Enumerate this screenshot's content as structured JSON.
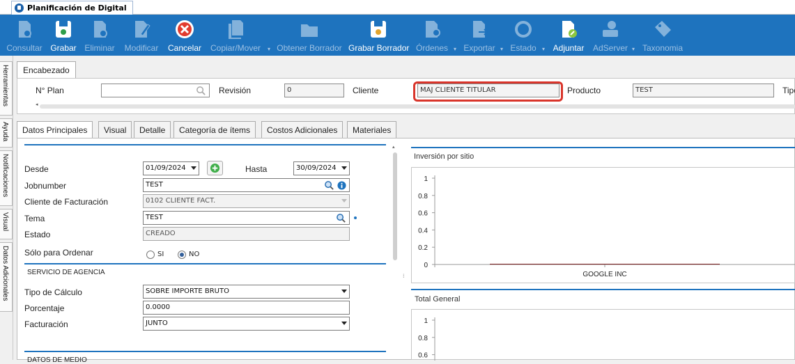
{
  "window": {
    "title": "Planificación de Digital"
  },
  "toolbar": {
    "buttons": [
      {
        "label": "Consultar",
        "icon": "consult-icon",
        "enabled": false
      },
      {
        "label": "Grabar",
        "icon": "save-icon",
        "enabled": true
      },
      {
        "label": "Eliminar",
        "icon": "delete-icon",
        "enabled": false
      },
      {
        "label": "Modificar",
        "icon": "edit-icon",
        "enabled": false
      },
      {
        "label": "Cancelar",
        "icon": "cancel-icon",
        "enabled": true
      },
      {
        "label": "Copiar/Mover",
        "icon": "copy-icon",
        "enabled": false
      },
      {
        "label": "Obtener Borrador",
        "icon": "folder-icon",
        "enabled": false
      },
      {
        "label": "Grabar Borrador",
        "icon": "save-draft-icon",
        "enabled": true
      },
      {
        "label": "Órdenes",
        "icon": "orders-icon",
        "enabled": false
      },
      {
        "label": "Exportar",
        "icon": "export-icon",
        "enabled": false
      },
      {
        "label": "Estado",
        "icon": "status-icon",
        "enabled": false
      },
      {
        "label": "Adjuntar",
        "icon": "attach-icon",
        "enabled": true
      },
      {
        "label": "AdServer",
        "icon": "adserver-icon",
        "enabled": false
      },
      {
        "label": "Taxonomia",
        "icon": "tag-icon",
        "enabled": false
      }
    ]
  },
  "sidebar": {
    "tabs": [
      "Herramientas",
      "Ayuda",
      "Notificaciones",
      "Visual",
      "Datos Adicionales"
    ]
  },
  "header": {
    "tab": "Encabezado",
    "plan_label": "N° Plan",
    "plan_value": "",
    "revision_label": "Revisión",
    "revision_value": "0",
    "cliente_label": "Cliente",
    "cliente_value": "MAJ CLIENTE TITULAR",
    "producto_label": "Producto",
    "producto_value": "TEST",
    "tipo_label": "Tipo"
  },
  "tabs": [
    "Datos Principales",
    "Visual",
    "Detalle",
    "Categoría de ítems",
    "Costos Adicionales",
    "Materiales"
  ],
  "form": {
    "desde_label": "Desde",
    "desde_value": "01/09/2024",
    "hasta_label": "Hasta",
    "hasta_value": "30/09/2024",
    "jobnumber_label": "Jobnumber",
    "jobnumber_value": "TEST",
    "cliente_fact_label": "Cliente de Facturación",
    "cliente_fact_value": "0102 CLIENTE FACT.",
    "tema_label": "Tema",
    "tema_value": "TEST",
    "estado_label": "Estado",
    "estado_value": "CREADO",
    "solo_label": "Sólo para Ordenar",
    "si_label": "SI",
    "no_label": "NO",
    "solo_selected": "NO",
    "agency_section": "SERVICIO DE AGENCIA",
    "calculo_label": "Tipo de Cálculo",
    "calculo_value": "SOBRE IMPORTE BRUTO",
    "porcentaje_label": "Porcentaje",
    "porcentaje_value": "0.0000",
    "facturacion_label": "Facturación",
    "facturacion_value": "JUNTO",
    "medio_section": "DATOS DE MEDIO"
  },
  "colors": {
    "accent": "#1e73be",
    "highlight": "#d9352b"
  },
  "chart_data": [
    {
      "type": "bar",
      "title": "Inversión por sitio",
      "categories": [
        "GOOGLE INC"
      ],
      "values": [
        0
      ],
      "ylim": [
        0,
        1
      ],
      "yticks": [
        "1",
        "0.8",
        "0.6",
        "0.4",
        "0.2",
        "0"
      ],
      "grid": false
    },
    {
      "type": "bar",
      "title": "Total General",
      "categories": [],
      "values": [],
      "ylim": [
        0,
        1
      ],
      "yticks": [
        "1",
        "0.8",
        "0.6"
      ],
      "grid": false
    }
  ]
}
